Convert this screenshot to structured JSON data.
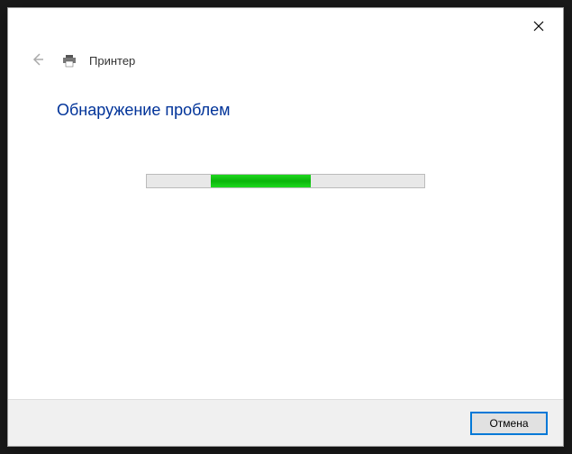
{
  "window": {
    "title": "Принтер"
  },
  "content": {
    "heading": "Обнаружение проблем"
  },
  "progress": {
    "left_percent": 23,
    "width_percent": 36
  },
  "footer": {
    "cancel_label": "Отмена"
  }
}
